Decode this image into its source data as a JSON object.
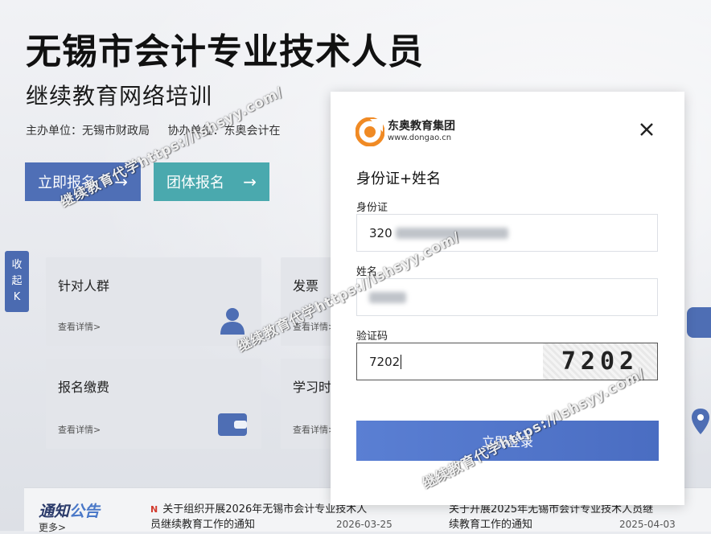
{
  "hero": {
    "title": "无锡市会计专业技术人员",
    "subtitle": "继续教育网络培训",
    "host": "主办单位：无锡市财政局",
    "co_host": "协办单位：东奥会计在",
    "signup_button": "立即报名",
    "group_button": "团体报名",
    "arrow": "→"
  },
  "sidebar_tab": {
    "line1": "收",
    "line2": "起",
    "line3": "K"
  },
  "cards": [
    {
      "title": "针对人群",
      "more": "查看详情>"
    },
    {
      "title": "发票",
      "more": "查看详情>"
    },
    {
      "title": "报名缴费",
      "more": "查看详情>"
    },
    {
      "title": "学习时",
      "more": "查看详情>"
    }
  ],
  "notices": {
    "logo_part1": "通知",
    "logo_part2": "公告",
    "more": "更多>",
    "new_flag": "N",
    "items": [
      {
        "title_line1": "关于组织开展2026年无锡市会计专业技术人",
        "title_line2": "员继续教育工作的通知",
        "date": "2026-03-25"
      },
      {
        "title_line1": "关于开展2025年无锡市会计专业技术人员继",
        "title_line2": "续教育工作的通知",
        "date": "2025-04-03"
      }
    ]
  },
  "modal": {
    "brand_name": "东奥教育集团",
    "brand_url": "www.dongao.cn",
    "close": "×",
    "title": "身份证+姓名",
    "id_label": "身份证",
    "id_value": "320",
    "name_label": "姓名",
    "captcha_label": "验证码",
    "captcha_value": "7202",
    "captcha_image_text": "7202",
    "login_button": "立即登录"
  },
  "watermark": "继续教育代学https://lshsyy.com/",
  "colors": {
    "primary": "#4f6fb6",
    "teal": "#4aa9ae",
    "login": "#4a6dc2",
    "brand_orange": "#f08a24"
  }
}
